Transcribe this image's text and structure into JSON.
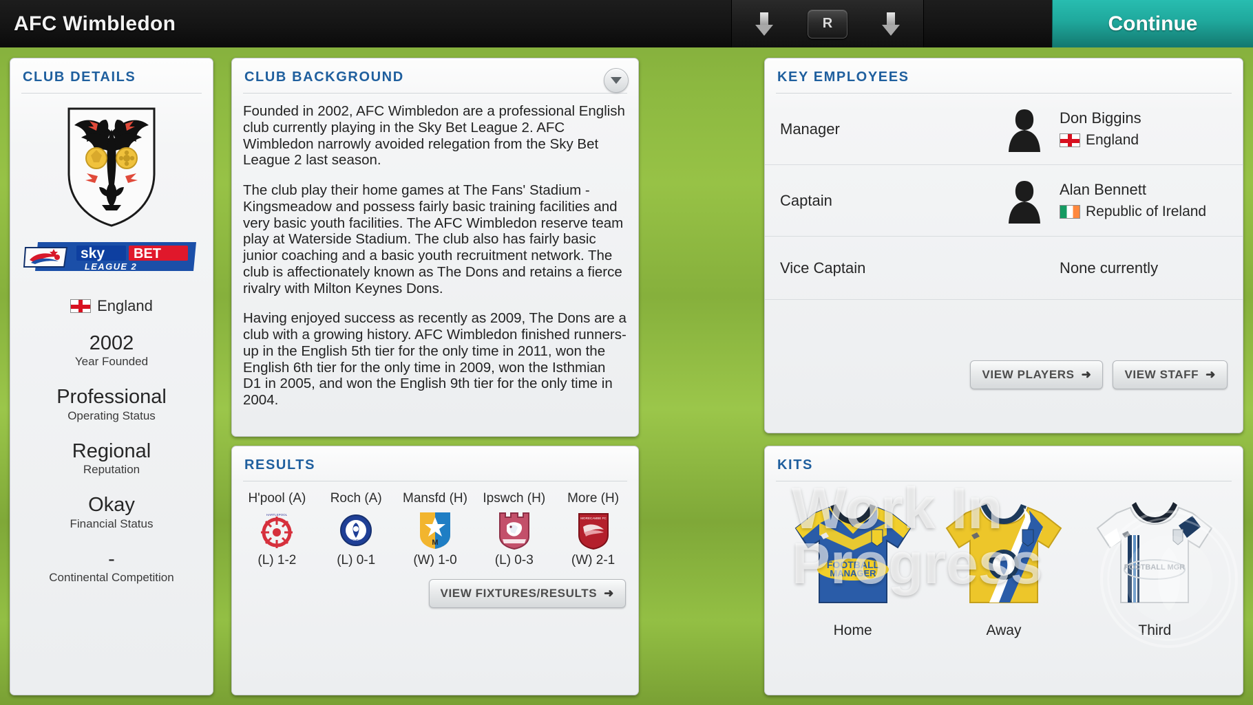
{
  "header": {
    "club_title": "AFC Wimbledon",
    "nav": {
      "back_arrow_icon": "arrow-down-icon",
      "forward_arrow_icon": "arrow-down-icon",
      "r_button_label": "R"
    },
    "continue_label": "Continue"
  },
  "club_details": {
    "title": "CLUB DETAILS",
    "crest_icon": "club-crest-double-eagle",
    "league_logo": {
      "sky": "sky",
      "bet": "BET",
      "league": "LEAGUE 2"
    },
    "country": "England",
    "country_flag": "flag-england",
    "stats": [
      {
        "value": "2002",
        "label": "Year Founded"
      },
      {
        "value": "Professional",
        "label": "Operating Status"
      },
      {
        "value": "Regional",
        "label": "Reputation"
      },
      {
        "value": "Okay",
        "label": "Financial Status"
      },
      {
        "value": "-",
        "label": "Continental Competition"
      }
    ]
  },
  "club_background": {
    "title": "CLUB BACKGROUND",
    "dropdown_icon": "chevron-down-icon",
    "paragraphs": [
      "Founded in 2002, AFC Wimbledon are a professional English club currently playing in the Sky Bet League 2. AFC Wimbledon narrowly avoided relegation from the Sky Bet League 2 last season.",
      "The club play their home games at The Fans' Stadium - Kingsmeadow and possess fairly basic training facilities and very basic youth facilities. The AFC Wimbledon reserve team play at Waterside Stadium. The club also has fairly basic junior coaching and a basic youth recruitment network. The club is affectionately known as The Dons and retains a fierce rivalry with Milton Keynes Dons.",
      "Having enjoyed success as recently as 2009, The Dons are a club with a growing history.  AFC Wimbledon finished runners-up in the English 5th tier for the only time in 2011, won the English 6th tier for the only time in 2009, won the Isthmian D1 in 2005, and won the English 9th tier for the only time in 2004."
    ]
  },
  "results": {
    "title": "RESULTS",
    "matches": [
      {
        "opponent": "H'pool (A)",
        "score": "(L) 1-2",
        "badge_icon": "hartlepool-badge",
        "outcome": "L"
      },
      {
        "opponent": "Roch (A)",
        "score": "(L) 0-1",
        "badge_icon": "rochdale-badge",
        "outcome": "L"
      },
      {
        "opponent": "Mansfd (H)",
        "score": "(W) 1-0",
        "badge_icon": "mansfield-badge",
        "outcome": "W"
      },
      {
        "opponent": "Ipswch (H)",
        "score": "(L) 0-3",
        "badge_icon": "ipswich-badge",
        "outcome": "L"
      },
      {
        "opponent": "More (H)",
        "score": "(W) 2-1",
        "badge_icon": "morecambe-badge",
        "outcome": "W"
      }
    ],
    "view_button_label": "VIEW FIXTURES/RESULTS",
    "view_button_arrow": "arrow-right-icon"
  },
  "key_employees": {
    "title": "KEY EMPLOYEES",
    "rows": [
      {
        "role": "Manager",
        "name": "Don Biggins",
        "nationality": "England",
        "flag": "flag-england",
        "avatar_icon": "person-silhouette-icon"
      },
      {
        "role": "Captain",
        "name": "Alan Bennett",
        "nationality": "Republic of Ireland",
        "flag": "flag-ireland",
        "avatar_icon": "person-silhouette-icon"
      }
    ],
    "vice_captain": {
      "role": "Vice Captain",
      "value": "None currently"
    },
    "view_players_label": "VIEW PLAYERS",
    "view_staff_label": "VIEW STAFF",
    "button_arrow": "arrow-right-icon"
  },
  "kits": {
    "title": "KITS",
    "items": [
      {
        "label": "Home",
        "kit_icon": "home-kit-blue-yellow",
        "primary": "#2a5ca8",
        "secondary": "#f2cf2a"
      },
      {
        "label": "Away",
        "kit_icon": "away-kit-yellow-sash",
        "primary": "#edc62a",
        "secondary": "#2a5ca8"
      },
      {
        "label": "Third",
        "kit_icon": "third-kit-white-navy",
        "primary": "#f4f4f4",
        "secondary": "#1e3c62"
      }
    ],
    "watermark": "Work In\nProgress"
  },
  "colors": {
    "accent_teal": "#1fa89c",
    "panel_title_blue": "#1f5f9e",
    "pitch_green": "#8cb840",
    "topbar_black": "#151515"
  }
}
